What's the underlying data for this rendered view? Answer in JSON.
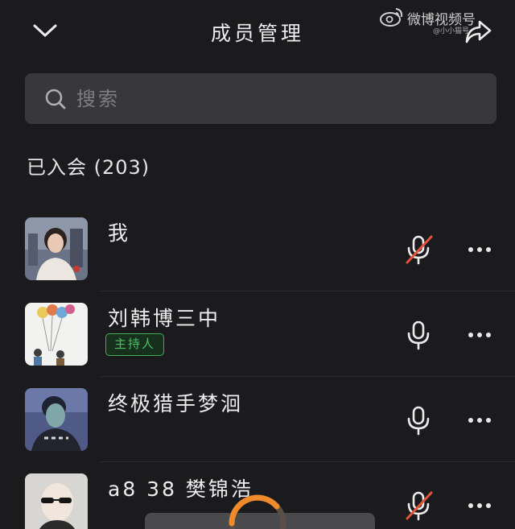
{
  "header": {
    "title": "成员管理",
    "watermark": "微博视频号",
    "watermark_sub": "@小小猫号"
  },
  "search": {
    "placeholder": "搜索"
  },
  "section": {
    "label": "已入会 (203)"
  },
  "members": [
    {
      "name": "我",
      "badge": "",
      "mic": "muted"
    },
    {
      "name": "刘韩博三中",
      "badge": "主持人",
      "mic": "on"
    },
    {
      "name": "终极猎手梦洄",
      "badge": "",
      "mic": "on"
    },
    {
      "name": "a8 38 樊锦浩",
      "badge": "",
      "mic": "muted"
    }
  ],
  "colors": {
    "background": "#1b1b1d",
    "search_bg": "#38383a",
    "host_badge": "#3fae55",
    "mute_slash": "#e5533d",
    "loader_accent": "#f08a2a"
  },
  "icons": [
    "chevron-down-icon",
    "weibo-logo-icon",
    "share-icon",
    "search-icon",
    "microphone-icon",
    "microphone-muted-icon",
    "more-icon"
  ]
}
